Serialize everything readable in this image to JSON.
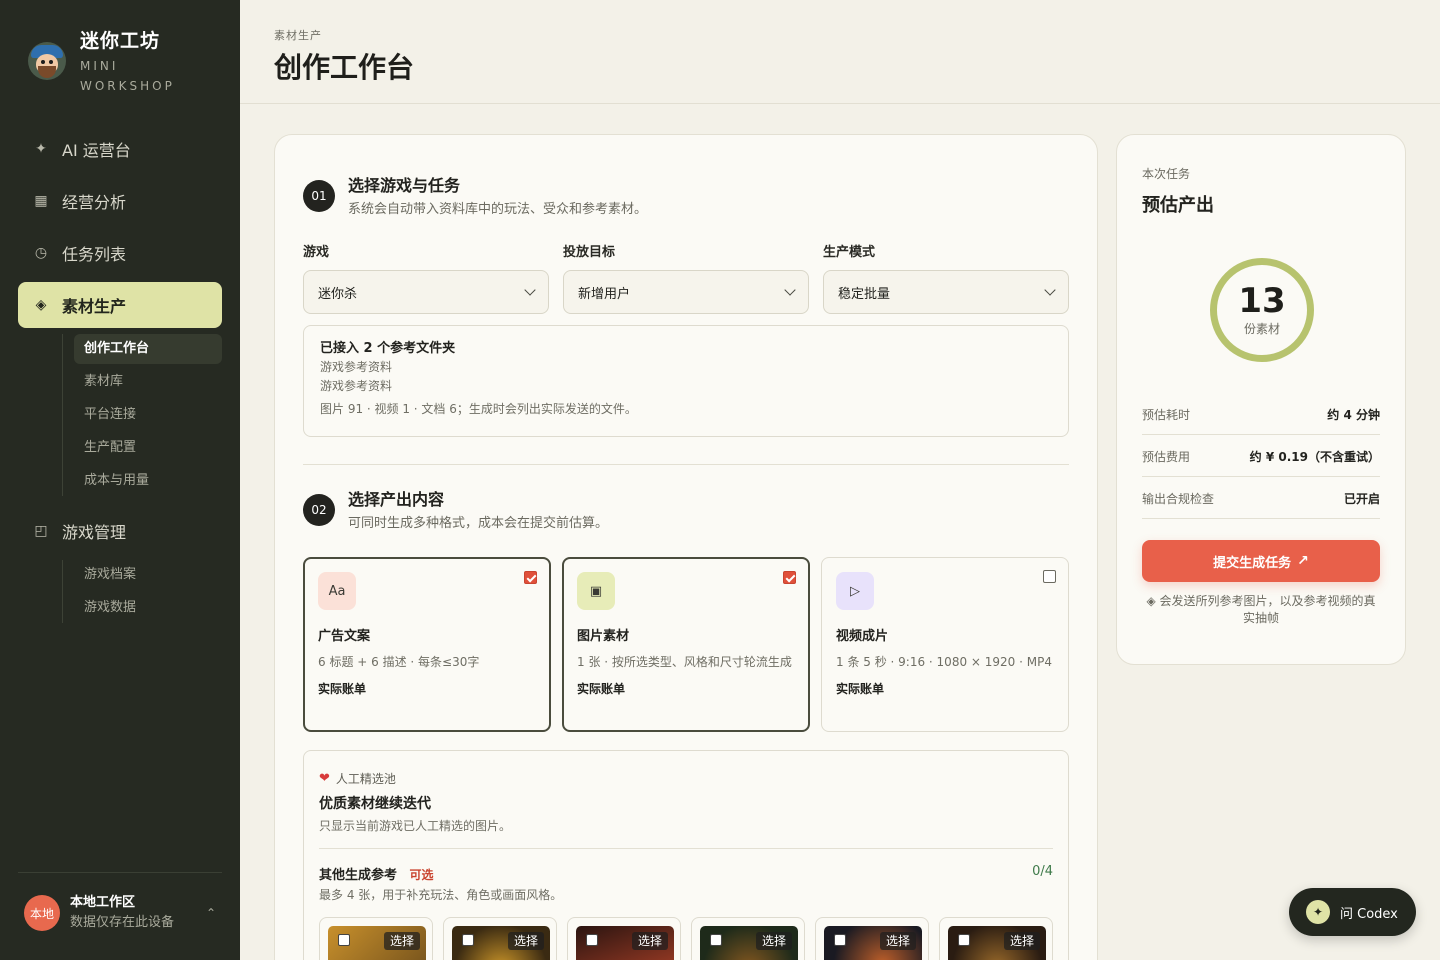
{
  "brand": {
    "title": "迷你工坊",
    "sub1": "MINI",
    "sub2": "WORKSHOP"
  },
  "nav": {
    "items": [
      {
        "label": "AI 运营台",
        "icon": "sparkle-icon"
      },
      {
        "label": "经营分析",
        "icon": "grid-icon"
      },
      {
        "label": "任务列表",
        "icon": "clock-icon"
      },
      {
        "label": "素材生产",
        "icon": "diamond-icon",
        "active": true
      },
      {
        "label": "游戏管理",
        "icon": "window-icon"
      }
    ],
    "material_sub": [
      "创作工作台",
      "素材库",
      "平台连接",
      "生产配置",
      "成本与用量"
    ],
    "game_sub": [
      "游戏档案",
      "游戏数据"
    ]
  },
  "workspace": {
    "avatar": "本地",
    "title": "本地工作区",
    "sub": "数据仅存在此设备"
  },
  "header": {
    "breadcrumb": "素材生产",
    "title": "创作工作台"
  },
  "step1": {
    "num": "01",
    "title": "选择游戏与任务",
    "desc": "系统会自动带入资料库中的玩法、受众和参考素材。",
    "fields": [
      {
        "label": "游戏",
        "value": "迷你杀"
      },
      {
        "label": "投放目标",
        "value": "新增用户"
      },
      {
        "label": "生产模式",
        "value": "稳定批量"
      }
    ],
    "refs": {
      "title": "已接入 2 个参考文件夹",
      "folders": [
        "游戏参考资料",
        "游戏参考资料"
      ],
      "stats": "图片 91 · 视频 1 · 文档 6；生成时会列出实际发送的文件。"
    }
  },
  "step2": {
    "num": "02",
    "title": "选择产出内容",
    "desc": "可同时生成多种格式，成本会在提交前估算。",
    "options": [
      {
        "icon_text": "Aa",
        "title": "广告文案",
        "desc": "6 标题 + 6 描述 · 每条≤30字",
        "bill": "实际账单",
        "checked": true,
        "color": "#fbe1d8"
      },
      {
        "icon_text": "▣",
        "title": "图片素材",
        "desc": "1 张 · 按所选类型、风格和尺寸轮流生成",
        "bill": "实际账单",
        "checked": true,
        "color": "#e7ecb8"
      },
      {
        "icon_text": "▷",
        "title": "视频成片",
        "desc": "1 条 5 秒 · 9:16 · 1080 × 1920 · MP4",
        "bill": "实际账单",
        "checked": false,
        "color": "#e8e2fb"
      }
    ]
  },
  "pool": {
    "tag": "人工精选池",
    "title": "优质素材继续迭代",
    "desc": "只显示当前游戏已人工精选的图片。",
    "ref_label": "其他生成参考",
    "optional": "可选",
    "count": "0/4",
    "hint": "最多 4 张，用于补充玩法、角色或画面风格。",
    "pick_label": "选择",
    "thumbs": [
      {
        "colors": [
          "#c8902c",
          "#6a4a1a"
        ]
      },
      {
        "colors": [
          "#3a2a12",
          "#d19a2a"
        ]
      },
      {
        "colors": [
          "#2a1410",
          "#b8452a"
        ]
      },
      {
        "colors": [
          "#1e2a1a",
          "#8a5a20"
        ]
      },
      {
        "colors": [
          "#1a1a22",
          "#c0602a"
        ]
      },
      {
        "colors": [
          "#2a1c12",
          "#9a6a2a"
        ]
      }
    ]
  },
  "summary": {
    "label": "本次任务",
    "title": "预估产出",
    "count": "13",
    "unit": "份素材",
    "rows": [
      {
        "k": "预估耗时",
        "v": "约 4 分钟"
      },
      {
        "k": "预估费用",
        "v": "约 ¥ 0.19（不含重试）"
      },
      {
        "k": "输出合规检查",
        "v": "已开启"
      }
    ],
    "submit": "提交生成任务",
    "note": "◈ 会发送所列参考图片，以及参考视频的真实抽帧"
  },
  "codex": {
    "label": "问 Codex"
  }
}
